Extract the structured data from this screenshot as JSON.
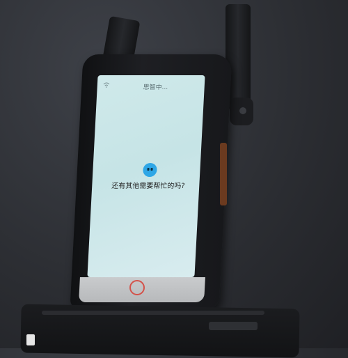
{
  "screen": {
    "status_title": "思智中...",
    "prompt_text": "还有其他需要帮忙的吗?"
  },
  "icons": {
    "status": "wifi-icon",
    "assistant": "smiley-face-icon",
    "home": "home-button-ring-icon"
  },
  "colors": {
    "screen": "#cfe9ea",
    "assistant_face": "#2ea6e6",
    "home_ring": "#d4524a"
  }
}
